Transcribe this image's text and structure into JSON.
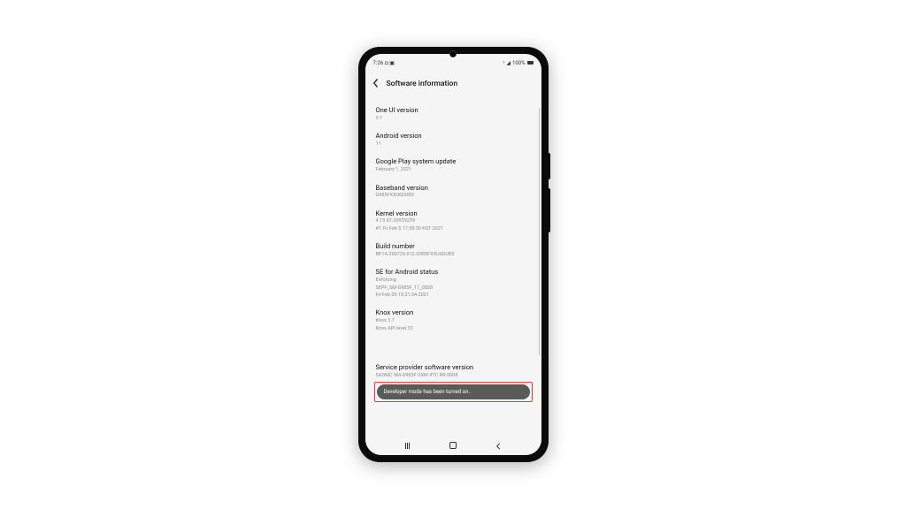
{
  "statusbar": {
    "time": "7:26",
    "icons_left": "◘ ▣",
    "wifi": "⬫",
    "signal": "◢",
    "battery_pct": "100%"
  },
  "header": {
    "title": "Software information"
  },
  "rows": {
    "oneui": {
      "title": "One UI version",
      "value": "3.1"
    },
    "android": {
      "title": "Android version",
      "value": "11"
    },
    "play": {
      "title": "Google Play system update",
      "value": "February 1, 2021"
    },
    "baseband": {
      "title": "Baseband version",
      "value": "G985FXXU6DUB5"
    },
    "kernel": {
      "title": "Kernel version",
      "value_line1": "4.19.87-20939239",
      "value_line2": "#1 Fri Feb 5 17:58:30 KST 2021"
    },
    "build": {
      "title": "Build number",
      "value": "RP1A.200720.012.G985FXXU6DUB5"
    },
    "se": {
      "title": "SE for Android status",
      "value_line1": "Enforcing",
      "value_line2": "SEPF_SM-G985F_11_0008",
      "value_line3": "Fri Feb 05 18:21:34 2021"
    },
    "knox": {
      "title": "Knox version",
      "value_line1": "Knox 3.7",
      "value_line2": "Knox API level 33"
    },
    "spsv": {
      "title": "Service provider software version",
      "value": "SAOMC  SM-G985F  OXM  XTC  RR  0008"
    }
  },
  "toast": {
    "message": "Developer mode has been turned on."
  }
}
